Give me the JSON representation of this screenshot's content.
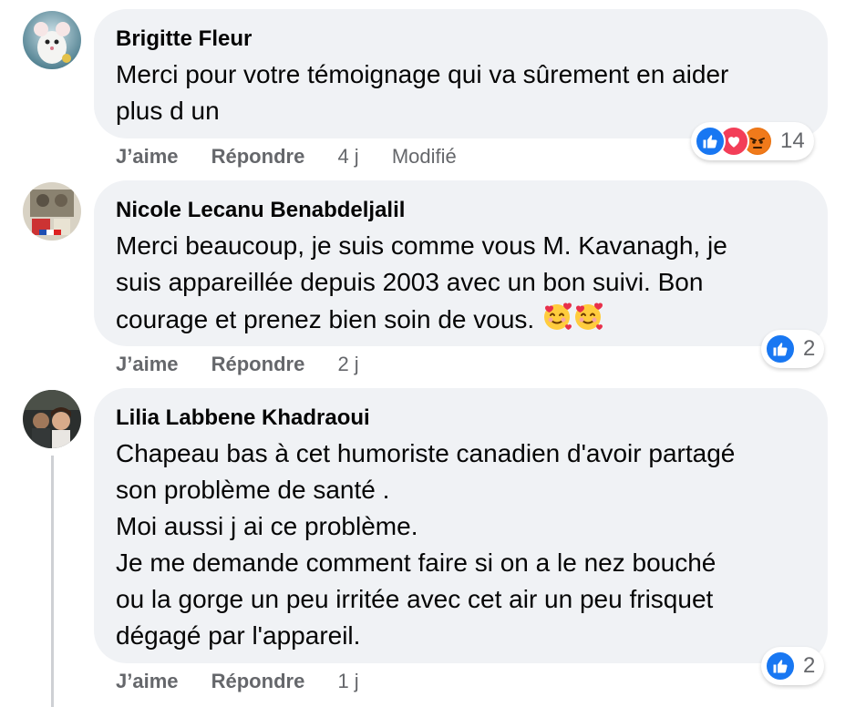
{
  "comments": [
    {
      "author": "Brigitte Fleur",
      "text": "Merci pour votre témoignage qui va sûrement en aider\nplus d un",
      "like_label": "J’aime",
      "reply_label": "Répondre",
      "time": "4 j",
      "edited": "Modifié",
      "reaction_count": "14",
      "reactions": [
        "like",
        "love",
        "angry"
      ]
    },
    {
      "author": "Nicole Lecanu Benabdeljalil",
      "text_lines": [
        "Merci beaucoup, je suis comme vous M. Kavanagh, je",
        "suis appareillée depuis 2003 avec un bon suivi. Bon",
        "courage et prenez bien soin de vous."
      ],
      "like_label": "J’aime",
      "reply_label": "Répondre",
      "time": "2 j",
      "reaction_count": "2",
      "reactions": [
        "like"
      ],
      "inline_emojis": [
        "smiling-face-with-hearts",
        "smiling-face-with-hearts"
      ]
    },
    {
      "author": "Lilia Labbene Khadraoui",
      "text": "Chapeau bas à cet humoriste canadien d'avoir partagé\nson problème de santé .\nMoi aussi j ai ce problème.\nJe me demande comment faire si on a le nez bouché\nou la gorge un peu irritée avec cet air un peu frisquet\ndégagé par l'appareil.",
      "like_label": "J’aime",
      "reply_label": "Répondre",
      "time": "1 j",
      "reaction_count": "2",
      "reactions": [
        "like"
      ]
    }
  ],
  "colors": {
    "bubble": "#f0f2f5",
    "meta_text": "#65676b",
    "like_blue": "#1877f2",
    "love_red": "#f33e58",
    "angry_orange": "#e9710f"
  }
}
